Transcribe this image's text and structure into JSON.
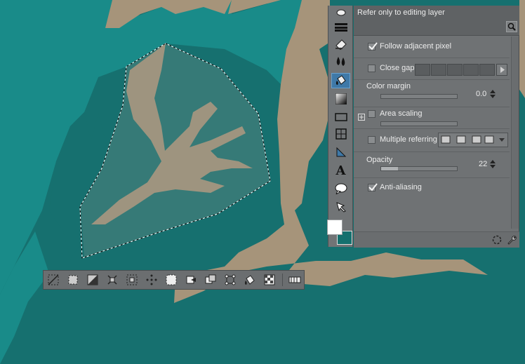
{
  "canvas": {
    "background_color": "#16706f",
    "left_region_color": "#198b89",
    "object_color": "#a6947a",
    "selection_fill": "rgba(150,160,150,0.45)"
  },
  "toolbar": {
    "tools": [
      {
        "name": "layer-move-icon"
      },
      {
        "name": "menu-bars-icon"
      },
      {
        "name": "eraser-icon"
      },
      {
        "name": "blend-drops-icon"
      },
      {
        "name": "fill-bucket-icon",
        "active": true
      },
      {
        "name": "gradient-icon"
      },
      {
        "name": "rectangle-figure-icon"
      },
      {
        "name": "frame-border-icon"
      },
      {
        "name": "ruler-icon"
      },
      {
        "name": "text-icon"
      },
      {
        "name": "balloon-icon"
      },
      {
        "name": "correct-line-icon"
      }
    ],
    "text_tool_glyph": "A"
  },
  "colors": {
    "foreground": "#ffffff",
    "background": "#15706e"
  },
  "tool_property": {
    "refer_label": "Refer only to editing layer",
    "follow_adjacent_pixel": {
      "label": "Follow adjacent pixel",
      "checked": true
    },
    "close_gap": {
      "label": "Close gap",
      "checked": false
    },
    "color_margin": {
      "label": "Color margin",
      "value": "0.0",
      "fill": 0.0
    },
    "area_scaling": {
      "label": "Area scaling",
      "checked": false
    },
    "multiple_referring": {
      "label": "Multiple referring",
      "checked": false
    },
    "opacity": {
      "label": "Opacity",
      "value": "22",
      "fill": 0.22
    },
    "anti_aliasing": {
      "label": "Anti-aliasing",
      "checked": true
    }
  },
  "selection_launcher": {
    "buttons": [
      {
        "name": "deselect-icon"
      },
      {
        "name": "show-selection-icon"
      },
      {
        "name": "invert-selection-icon"
      },
      {
        "name": "expand-selection-icon"
      },
      {
        "name": "shrink-selection-icon"
      },
      {
        "name": "selection-points-icon"
      },
      {
        "name": "fill-selection-icon"
      },
      {
        "name": "cut-paste-icon"
      },
      {
        "name": "copy-paste-icon"
      },
      {
        "name": "scale-rotate-icon"
      },
      {
        "name": "fill-bucket-icon"
      },
      {
        "name": "transparency-icon"
      },
      {
        "name": "launcher-settings-icon"
      }
    ]
  }
}
